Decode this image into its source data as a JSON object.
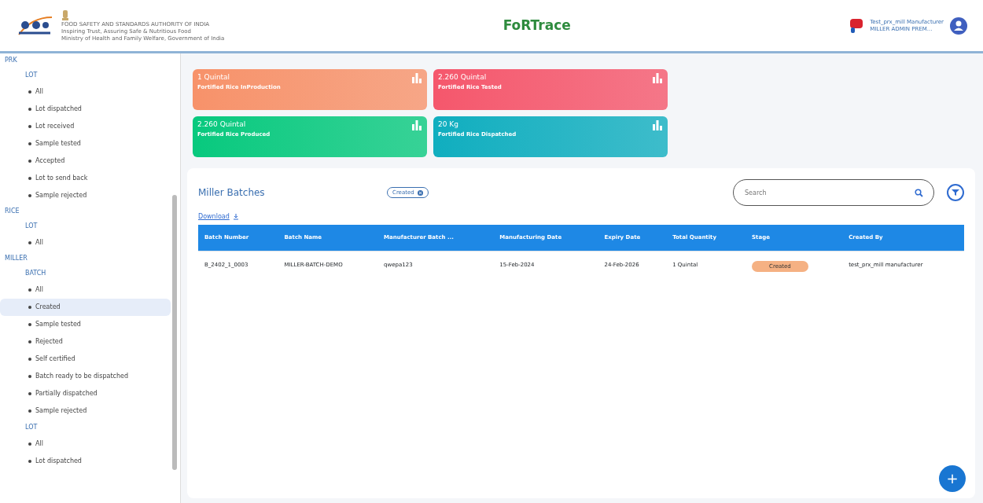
{
  "header": {
    "org_name": "FOOD SAFETY AND STANDARDS AUTHORITY OF INDIA",
    "tagline": "Inspiring Trust, Assuring Safe & Nutritious Food",
    "ministry": "Ministry of Health and Family Welfare, Government of India",
    "app_title": "FoRTrace",
    "user_name": "Test_prx_mill Manufacturer",
    "user_role": "MILLER ADMIN PREM..."
  },
  "sidebar": {
    "items": [
      {
        "label": "PRK",
        "children": [
          {
            "label": "LOT",
            "children": [
              {
                "label": "All",
                "selected": false
              },
              {
                "label": "Lot dispatched",
                "selected": false
              },
              {
                "label": "Lot received",
                "selected": false
              },
              {
                "label": "Sample tested",
                "selected": false
              },
              {
                "label": "Accepted",
                "selected": false
              },
              {
                "label": "Lot to send back",
                "selected": false
              },
              {
                "label": "Sample rejected",
                "selected": false
              }
            ]
          }
        ]
      },
      {
        "label": "RICE",
        "children": [
          {
            "label": "LOT",
            "children": [
              {
                "label": "All",
                "selected": false
              }
            ]
          }
        ]
      },
      {
        "label": "MILLER",
        "children": [
          {
            "label": "BATCH",
            "children": [
              {
                "label": "All",
                "selected": false
              },
              {
                "label": "Created",
                "selected": true
              },
              {
                "label": "Sample tested",
                "selected": false
              },
              {
                "label": "Rejected",
                "selected": false
              },
              {
                "label": "Self certified",
                "selected": false
              },
              {
                "label": "Batch ready to be dispatched",
                "selected": false
              },
              {
                "label": "Partially dispatched",
                "selected": false
              },
              {
                "label": "Sample rejected",
                "selected": false
              }
            ]
          },
          {
            "label": "LOT",
            "children": [
              {
                "label": "All",
                "selected": false
              },
              {
                "label": "Lot dispatched",
                "selected": false
              }
            ]
          }
        ]
      }
    ]
  },
  "stats": [
    {
      "value": "1 Quintal",
      "label": "Fortified Rice InProduction",
      "color": "#f7926a"
    },
    {
      "value": "2.260 Quintal",
      "label": "Fortified Rice Tested",
      "color": "#f5576c"
    },
    {
      "value": "2.260 Quintal",
      "label": "Fortified Rice Produced",
      "color": "#08c97e"
    },
    {
      "value": "20 Kg",
      "label": "Fortified Rice Dispatched",
      "color": "#10aebf"
    }
  ],
  "batches": {
    "title": "Miller Batches",
    "filter_chip": "Created",
    "search": {
      "placeholder": "Search"
    },
    "download": "Download",
    "table": {
      "columns": [
        "Batch Number",
        "Batch Name",
        "Manufacturer Batch ...",
        "Manufacturing Date",
        "Expiry Date",
        "Total Quantity",
        "Stage",
        "Created By"
      ],
      "rows": [
        {
          "cells": [
            {
              "kind": "text",
              "text": "B_2402_1_0003"
            },
            {
              "kind": "text",
              "text": "MILLER-BATCH-DEMO"
            },
            {
              "kind": "text",
              "text": "qwepa123"
            },
            {
              "kind": "text",
              "text": "15-Feb-2024"
            },
            {
              "kind": "text",
              "text": "24-Feb-2026"
            },
            {
              "kind": "text",
              "text": "1 Quintal"
            },
            {
              "kind": "badge",
              "text": "Created"
            },
            {
              "kind": "text",
              "text": "test_prx_mill manufacturer"
            }
          ]
        }
      ]
    }
  },
  "fab": "+"
}
